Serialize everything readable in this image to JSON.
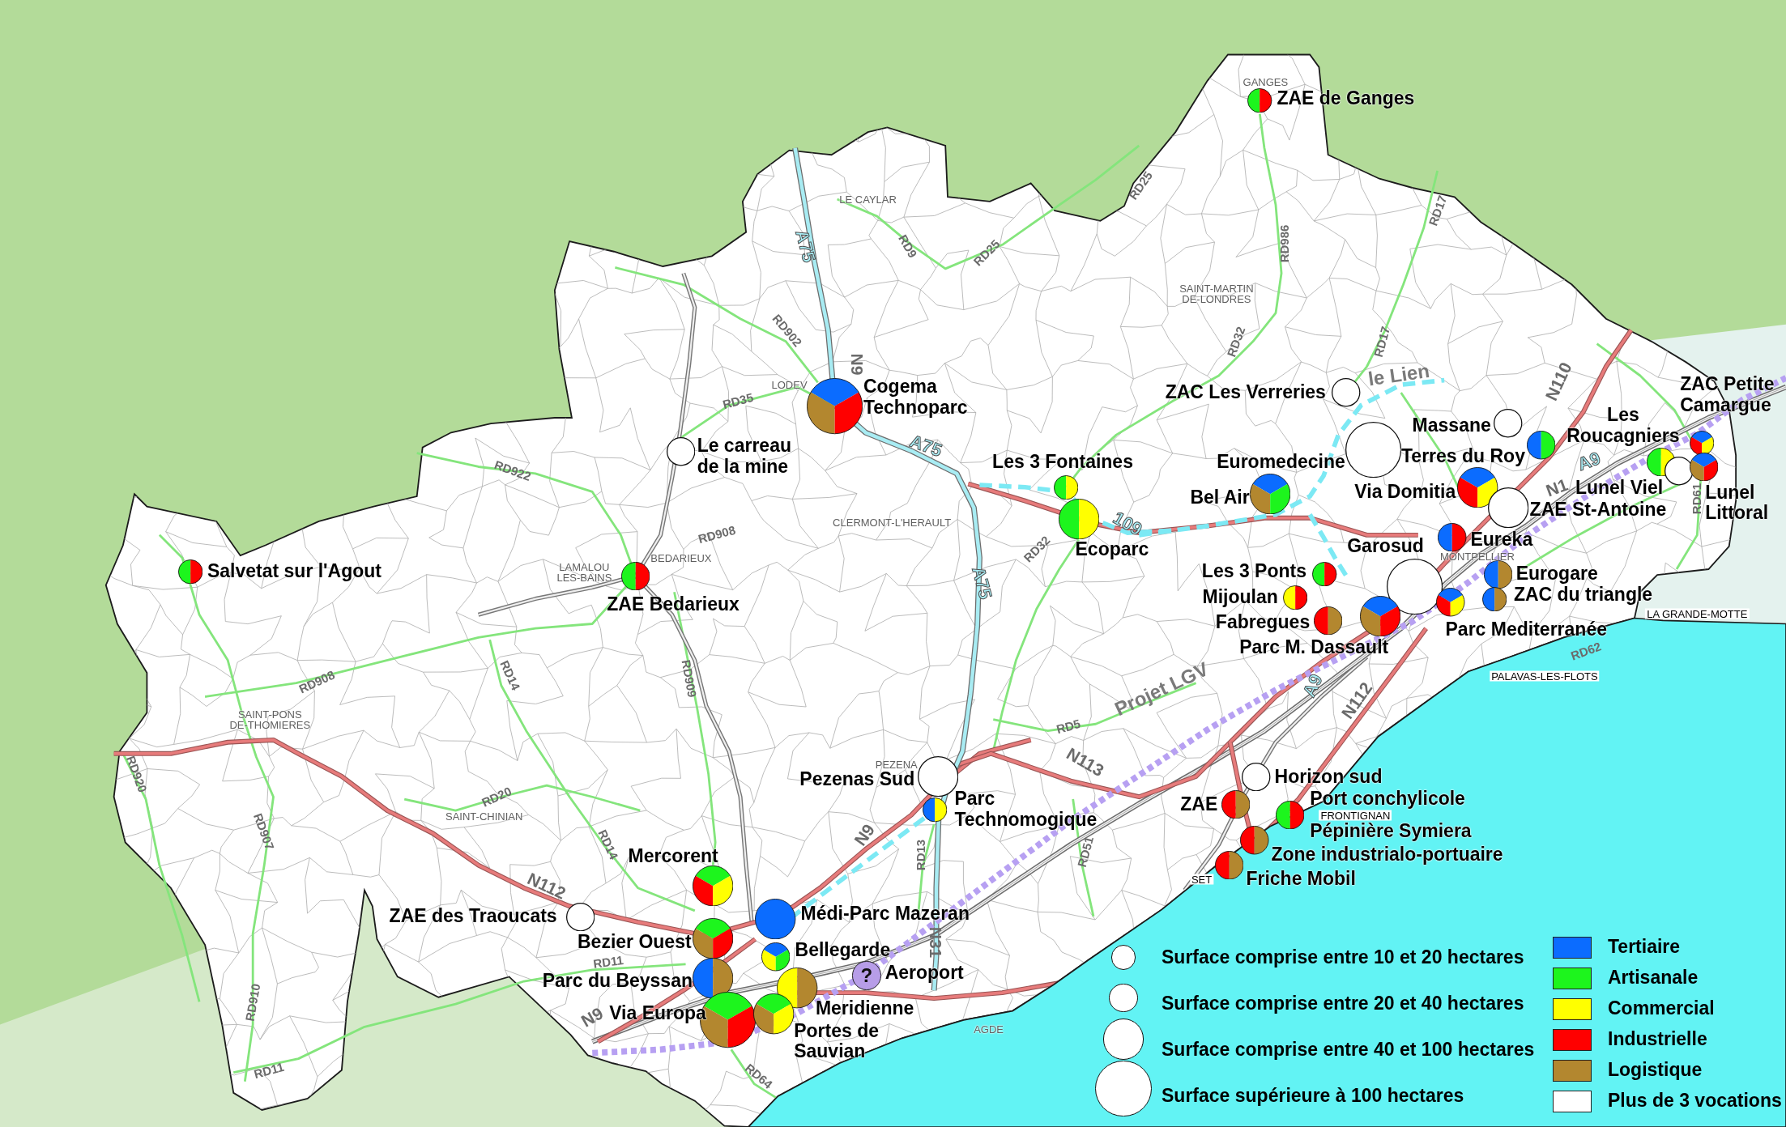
{
  "road_labels": [
    {
      "label": "RD25",
      "kind": "departmental"
    },
    {
      "label": "RD17",
      "kind": "departmental"
    },
    {
      "label": "A75",
      "kind": "motorway"
    },
    {
      "label": "RD9",
      "kind": "departmental"
    },
    {
      "label": "RD25",
      "kind": "departmental"
    },
    {
      "label": "RD986",
      "kind": "departmental"
    },
    {
      "label": "RD902",
      "kind": "departmental"
    },
    {
      "label": "RD32",
      "kind": "departmental"
    },
    {
      "label": "RD17",
      "kind": "departmental"
    },
    {
      "label": "N9",
      "kind": "national"
    },
    {
      "label": "le Lien",
      "kind": "project"
    },
    {
      "label": "RD35",
      "kind": "departmental"
    },
    {
      "label": "N110",
      "kind": "national"
    },
    {
      "label": "A75",
      "kind": "motorway"
    },
    {
      "label": "RD922",
      "kind": "departmental"
    },
    {
      "label": "A9",
      "kind": "motorway"
    },
    {
      "label": "N1",
      "kind": "national"
    },
    {
      "label": "RD61",
      "kind": "departmental"
    },
    {
      "label": "RD908",
      "kind": "departmental"
    },
    {
      "label": "109",
      "kind": "motorway"
    },
    {
      "label": "RD32",
      "kind": "departmental"
    },
    {
      "label": "A75",
      "kind": "motorway"
    },
    {
      "label": "RD62",
      "kind": "departmental"
    },
    {
      "label": "RD908",
      "kind": "departmental"
    },
    {
      "label": "RD14",
      "kind": "departmental"
    },
    {
      "label": "RD909",
      "kind": "departmental"
    },
    {
      "label": "Projet LGV",
      "kind": "project"
    },
    {
      "label": "A9",
      "kind": "motorway"
    },
    {
      "label": "N112",
      "kind": "national"
    },
    {
      "label": "RD5",
      "kind": "departmental"
    },
    {
      "label": "RD920",
      "kind": "departmental"
    },
    {
      "label": "N113",
      "kind": "national"
    },
    {
      "label": "RD20",
      "kind": "departmental"
    },
    {
      "label": "RD907",
      "kind": "departmental"
    },
    {
      "label": "RD14",
      "kind": "departmental"
    },
    {
      "label": "N9",
      "kind": "national"
    },
    {
      "label": "RD13",
      "kind": "departmental"
    },
    {
      "label": "RD51",
      "kind": "departmental"
    },
    {
      "label": "N112",
      "kind": "national"
    },
    {
      "label": "N31",
      "kind": "national"
    },
    {
      "label": "RD11",
      "kind": "departmental"
    },
    {
      "label": "RD910",
      "kind": "departmental"
    },
    {
      "label": "N9",
      "kind": "national"
    },
    {
      "label": "RD11",
      "kind": "departmental"
    },
    {
      "label": "RD64",
      "kind": "departmental"
    }
  ],
  "towns": [
    {
      "name": "GANGES",
      "kind": "plain"
    },
    {
      "name": "LE CAYLAR",
      "kind": "plain"
    },
    {
      "name": "SAINT-MARTIN DE-LONDRES",
      "kind": "plain"
    },
    {
      "name": "LODEV",
      "kind": "plain"
    },
    {
      "name": "CLERMONT-L'HERAULT",
      "kind": "plain"
    },
    {
      "name": "BEDARIEUX",
      "kind": "plain"
    },
    {
      "name": "MONTPELLIER",
      "kind": "plain"
    },
    {
      "name": "LAMALOU LES-BAINS",
      "kind": "plain"
    },
    {
      "name": "LA GRANDE-MOTTE",
      "kind": "boxed"
    },
    {
      "name": "PALAVAS-LES-FLOTS",
      "kind": "boxed"
    },
    {
      "name": "SAINT-PONS DE-THOMIERES",
      "kind": "plain"
    },
    {
      "name": "PEZENA",
      "kind": "plain"
    },
    {
      "name": "SAINT-CHINIAN",
      "kind": "plain"
    },
    {
      "name": "FRONTIGNAN",
      "kind": "boxed"
    },
    {
      "name": "SET",
      "kind": "boxed"
    },
    {
      "name": "AGDE",
      "kind": "plain"
    }
  ],
  "zones": [
    {
      "name": "ZAE de Ganges",
      "kind": "pie",
      "marker": {
        "kind": "small",
        "slices": [
          {
            "color": "#1df51d"
          },
          {
            "color": "#ff0000"
          }
        ]
      }
    },
    {
      "name": "Cogema Technoparc",
      "kind": "pie",
      "marker": {
        "kind": "huge",
        "slices": [
          {
            "color": "#0b6cff"
          },
          {
            "color": "#b3872f"
          },
          {
            "color": "#ff0000"
          }
        ]
      }
    },
    {
      "name": "ZAC Les Verreries",
      "kind": "multi",
      "marker": {
        "kind": "medium"
      }
    },
    {
      "name": "ZAC Petite Camargue",
      "kind": "pie",
      "marker": {
        "kind": "small",
        "slices": [
          {
            "color": "#0b6cff"
          },
          {
            "color": "#ff0000"
          },
          {
            "color": "#ffff00"
          }
        ]
      }
    },
    {
      "name": "Massane",
      "kind": "multi",
      "marker": {
        "kind": "medium"
      }
    },
    {
      "name": "Les Roucagniers",
      "kind": "pie",
      "marker": {
        "kind": "medium",
        "slices": [
          {
            "color": "#1df51d"
          },
          {
            "color": "#ffff00"
          }
        ]
      }
    },
    {
      "name": "Le carreau de la mine",
      "kind": "multi",
      "marker": {
        "kind": "medium"
      }
    },
    {
      "name": "Les 3 Fontaines",
      "kind": "pie",
      "marker": {
        "kind": "small",
        "slices": [
          {
            "color": "#1df51d"
          },
          {
            "color": "#ffff00"
          }
        ]
      }
    },
    {
      "name": "Euromedecine",
      "kind": "multi",
      "marker": {
        "kind": "huge"
      }
    },
    {
      "name": "Terres du Roy",
      "kind": "pie",
      "marker": {
        "kind": "medium",
        "slices": [
          {
            "color": "#0b6cff"
          },
          {
            "color": "#1df51d"
          }
        ]
      }
    },
    {
      "name": "Bel Air",
      "kind": "pie",
      "marker": {
        "kind": "large",
        "slices": [
          {
            "color": "#0b6cff"
          },
          {
            "color": "#b3872f"
          },
          {
            "color": "#1df51d"
          }
        ]
      }
    },
    {
      "name": "Via Domitia",
      "kind": "pie",
      "marker": {
        "kind": "large",
        "slices": [
          {
            "color": "#0b6cff"
          },
          {
            "color": "#ff0000"
          },
          {
            "color": "#ffff00"
          }
        ]
      }
    },
    {
      "name": "Lunel Viel",
      "kind": "multi",
      "marker": {
        "kind": "medium"
      }
    },
    {
      "name": "ZAE St-Antoine",
      "kind": "multi",
      "marker": {
        "kind": "large"
      }
    },
    {
      "name": "Lunel Littoral",
      "kind": "pie",
      "marker": {
        "kind": "medium",
        "slices": [
          {
            "color": "#0b6cff"
          },
          {
            "color": "#b3872f"
          },
          {
            "color": "#ff0000"
          }
        ]
      }
    },
    {
      "name": "Ecoparc",
      "kind": "pie",
      "marker": {
        "kind": "large",
        "slices": [
          {
            "color": "#1df51d"
          },
          {
            "color": "#ffff00"
          }
        ]
      }
    },
    {
      "name": "Garosud",
      "kind": "multi",
      "marker": {
        "kind": "huge"
      }
    },
    {
      "name": "Eureka",
      "kind": "pie",
      "marker": {
        "kind": "medium",
        "slices": [
          {
            "color": "#0b6cff"
          },
          {
            "color": "#ff0000"
          }
        ]
      }
    },
    {
      "name": "Salvetat sur l'Agout",
      "kind": "pie",
      "marker": {
        "kind": "small",
        "slices": [
          {
            "color": "#1df51d"
          },
          {
            "color": "#ff0000"
          }
        ]
      }
    },
    {
      "name": "Les 3 Ponts",
      "kind": "pie",
      "marker": {
        "kind": "small",
        "slices": [
          {
            "color": "#1df51d"
          },
          {
            "color": "#ff0000"
          }
        ]
      }
    },
    {
      "name": "Eurogare",
      "kind": "pie",
      "marker": {
        "kind": "medium",
        "slices": [
          {
            "color": "#0b6cff"
          },
          {
            "color": "#b3872f"
          }
        ]
      }
    },
    {
      "name": "ZAE Bedarieux",
      "kind": "pie",
      "marker": {
        "kind": "medium",
        "slices": [
          {
            "color": "#1df51d"
          },
          {
            "color": "#ff0000"
          }
        ]
      }
    },
    {
      "name": "Mijoulan",
      "kind": "pie",
      "marker": {
        "kind": "small",
        "slices": [
          {
            "color": "#ffff00"
          },
          {
            "color": "#ff0000"
          }
        ]
      }
    },
    {
      "name": "ZAC du triangle",
      "kind": "pie",
      "marker": {
        "kind": "small",
        "slices": [
          {
            "color": "#0b6cff"
          },
          {
            "color": "#b3872f"
          }
        ]
      }
    },
    {
      "name": "Fabregues",
      "kind": "pie",
      "marker": {
        "kind": "medium",
        "slices": [
          {
            "color": "#ff0000"
          },
          {
            "color": "#b3872f"
          }
        ]
      }
    },
    {
      "name": "Parc Mediterranée",
      "kind": "pie",
      "marker": {
        "kind": "medium",
        "slices": [
          {
            "color": "#0b6cff"
          },
          {
            "color": "#ff0000"
          },
          {
            "color": "#ffff00"
          }
        ]
      }
    },
    {
      "name": "Parc M. Dassault",
      "kind": "pie",
      "marker": {
        "kind": "large",
        "slices": [
          {
            "color": "#0b6cff"
          },
          {
            "color": "#b3872f"
          },
          {
            "color": "#ff0000"
          }
        ]
      }
    },
    {
      "name": "Pezenas Sud",
      "kind": "multi",
      "marker": {
        "kind": "large"
      }
    },
    {
      "name": "Horizon sud",
      "kind": "multi",
      "marker": {
        "kind": "medium"
      }
    },
    {
      "name": "Parc Technomogique",
      "kind": "pie",
      "marker": {
        "kind": "small",
        "slices": [
          {
            "color": "#0b6cff"
          },
          {
            "color": "#ffff00"
          }
        ]
      }
    },
    {
      "name": "ZAE",
      "kind": "pie",
      "marker": {
        "kind": "medium",
        "slices": [
          {
            "color": "#ff0000"
          },
          {
            "color": "#b3872f"
          }
        ]
      }
    },
    {
      "name": "Port conchylicole",
      "kind": "label"
    },
    {
      "name": "Pépinière Symiera",
      "kind": "pie",
      "marker": {
        "kind": "medium",
        "slices": [
          {
            "color": "#1df51d"
          },
          {
            "color": "#ff0000"
          }
        ]
      }
    },
    {
      "name": "Mercorent",
      "kind": "pie",
      "marker": {
        "kind": "large",
        "slices": [
          {
            "color": "#1df51d"
          },
          {
            "color": "#ff0000"
          },
          {
            "color": "#ffff00"
          }
        ]
      }
    },
    {
      "name": "Zone industrialo-portuaire",
      "kind": "pie",
      "marker": {
        "kind": "medium",
        "slices": [
          {
            "color": "#ff0000"
          },
          {
            "color": "#b3872f"
          }
        ]
      }
    },
    {
      "name": "Friche Mobil",
      "kind": "pie",
      "marker": {
        "kind": "medium",
        "slices": [
          {
            "color": "#ff0000"
          },
          {
            "color": "#b3872f"
          }
        ]
      }
    },
    {
      "name": "ZAE des Traoucats",
      "kind": "multi",
      "marker": {
        "kind": "medium"
      }
    },
    {
      "name": "Médi-Parc Mazeran",
      "kind": "pie",
      "marker": {
        "kind": "large",
        "slices": [
          {
            "color": "#0b6cff"
          }
        ]
      }
    },
    {
      "name": "Bezier Ouest",
      "kind": "pie",
      "marker": {
        "kind": "large",
        "slices": [
          {
            "color": "#1df51d"
          },
          {
            "color": "#b3872f"
          },
          {
            "color": "#ff0000"
          }
        ]
      }
    },
    {
      "name": "Bellegarde",
      "kind": "pie",
      "marker": {
        "kind": "medium",
        "slices": [
          {
            "color": "#0b6cff"
          },
          {
            "color": "#ffff00"
          },
          {
            "color": "#1df51d"
          }
        ]
      }
    },
    {
      "name": "Parc du Beyssan",
      "kind": "pie",
      "marker": {
        "kind": "large",
        "slices": [
          {
            "color": "#0b6cff"
          },
          {
            "color": "#b3872f"
          }
        ]
      }
    },
    {
      "name": "Aeroport",
      "kind": "query",
      "marker": {
        "kind": "medium",
        "symbol": "?"
      }
    },
    {
      "name": "Via Europa",
      "kind": "pie",
      "marker": {
        "kind": "huge",
        "slices": [
          {
            "color": "#1df51d"
          },
          {
            "color": "#b3872f"
          },
          {
            "color": "#ff0000"
          }
        ]
      }
    },
    {
      "name": "Meridienne",
      "kind": "pie",
      "marker": {
        "kind": "large",
        "slices": [
          {
            "color": "#ffff00"
          },
          {
            "color": "#b3872f"
          }
        ]
      }
    },
    {
      "name": "Portes de Sauvian",
      "kind": "pie",
      "marker": {
        "kind": "large",
        "slices": [
          {
            "color": "#1df51d"
          },
          {
            "color": "#b3872f"
          },
          {
            "color": "#ffff00"
          }
        ]
      }
    }
  ],
  "legend": {
    "sizes": [
      {
        "kind": "small",
        "label": "Surface comprise entre 10 et 20 hectares"
      },
      {
        "kind": "medium",
        "label": "Surface comprise entre 20 et 40 hectares"
      },
      {
        "kind": "large",
        "label": "Surface comprise entre 40 et 100 hectares"
      },
      {
        "kind": "huge",
        "label": "Surface supérieure à 100 hectares"
      }
    ],
    "vocations": [
      {
        "label": "Tertiaire",
        "color": "#0b6cff"
      },
      {
        "label": "Artisanale",
        "color": "#1df51d"
      },
      {
        "label": "Commercial",
        "color": "#ffff00"
      },
      {
        "label": "Industrielle",
        "color": "#ff0000"
      },
      {
        "label": "Logistique",
        "color": "#b3872f"
      },
      {
        "label": "Plus de 3 vocations",
        "color": "#ffffff"
      }
    ]
  }
}
